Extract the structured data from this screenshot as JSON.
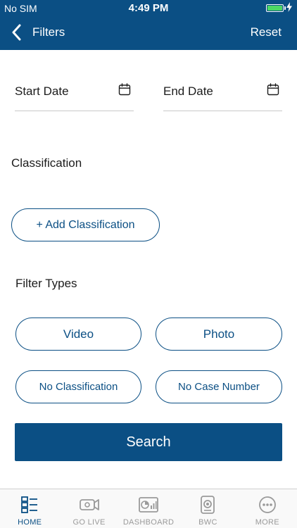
{
  "status_bar": {
    "carrier": "No SIM",
    "time": "4:49 PM"
  },
  "nav": {
    "title": "Filters",
    "reset_label": "Reset"
  },
  "dates": {
    "start_label": "Start Date",
    "end_label": "End Date"
  },
  "classification": {
    "title": "Classification",
    "add_label": "+ Add Classification"
  },
  "filter_types": {
    "title": "Filter Types",
    "options": [
      "Video",
      "Photo",
      "No Classification",
      "No Case Number"
    ]
  },
  "search_label": "Search",
  "tabbar": {
    "active": "HOME",
    "tabs": [
      {
        "label": "HOME",
        "icon": "home-list-icon"
      },
      {
        "label": "GO LIVE",
        "icon": "camera-icon"
      },
      {
        "label": "DASHBOARD",
        "icon": "dashboard-icon"
      },
      {
        "label": "BWC",
        "icon": "body-camera-icon"
      },
      {
        "label": "MORE",
        "icon": "more-icon"
      }
    ]
  },
  "colors": {
    "primary": "#0b4f84",
    "battery": "#4cd964",
    "inactive_tab": "#9a9a9a"
  }
}
